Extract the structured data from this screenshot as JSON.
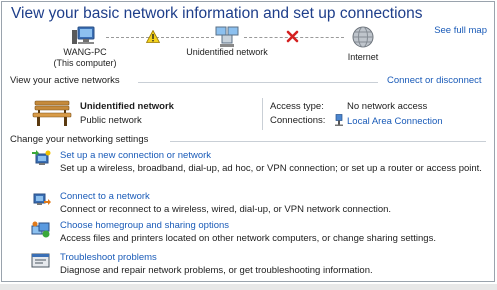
{
  "header": {
    "title": "View your basic network information and set up connections",
    "see_full_map": "See full map"
  },
  "network_map": {
    "computer": {
      "name": "WANG-PC",
      "subtitle": "(This computer)",
      "icon": "computer-icon"
    },
    "network": {
      "name": "Unidentified network",
      "icon": "network-icon"
    },
    "internet": {
      "name": "Internet",
      "icon": "globe-icon"
    },
    "link1_status": "warning-icon",
    "link2_status": "red-x-icon"
  },
  "active_networks": {
    "heading": "View your active networks",
    "connect_link": "Connect or disconnect",
    "network_name": "Unidentified network",
    "network_category": "Public network",
    "access_type_label": "Access type:",
    "access_type_value": "No network access",
    "connections_label": "Connections:",
    "connections_value": "Local Area Connection"
  },
  "settings": {
    "heading": "Change your networking settings",
    "tasks": [
      {
        "link": "Set up a new connection or network",
        "desc": "Set up a wireless, broadband, dial-up, ad hoc, or VPN connection; or set up a router or access point.",
        "icon": "new-connection-icon"
      },
      {
        "link": "Connect to a network",
        "desc": "Connect or reconnect to a wireless, wired, dial-up, or VPN network connection.",
        "icon": "connect-network-icon"
      },
      {
        "link": "Choose homegroup and sharing options",
        "desc": "Access files and printers located on other network computers, or change sharing settings.",
        "icon": "homegroup-icon"
      },
      {
        "link": "Troubleshoot problems",
        "desc": "Diagnose and repair network problems, or get troubleshooting information.",
        "icon": "troubleshoot-icon"
      }
    ]
  },
  "colors": {
    "title": "#1e3e8a",
    "link": "#1a5bb8",
    "divider": "#c9cfd6"
  }
}
